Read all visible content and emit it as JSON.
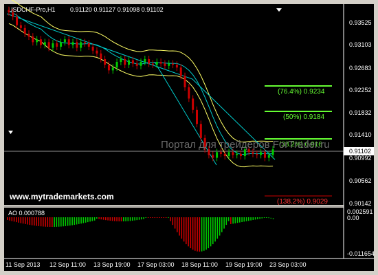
{
  "header": {
    "symbol_timeframe": "USDCHF-Pro,H1",
    "ohlc": "0.91120 0.91127 0.91098 0.91102"
  },
  "watermark": "Портал для трейдеров ForTrader.ru",
  "site_label": "www.mytrademarkets.com",
  "fib_levels": [
    {
      "label": "(76.4%) 0.9234",
      "color": "#66ff33"
    },
    {
      "label": "(50%) 0.9184",
      "color": "#66ff33"
    },
    {
      "label": "(38.2%) 0.916",
      "color": "#66ff33"
    },
    {
      "label": "(138.2%) 0.9029",
      "color": "#ff3333"
    }
  ],
  "price_axis": [
    "0.93525",
    "0.93103",
    "0.92683",
    "0.92252",
    "0.91832",
    "0.91410",
    "0.90992",
    "0.90562",
    "0.90142"
  ],
  "current_price": "0.91102",
  "ao_panel": {
    "label": "AO 0.000788",
    "axis": [
      "0.002591",
      "0.00",
      "-0.011654"
    ]
  },
  "time_axis": [
    "11 Sep 2013",
    "12 Sep 11:00",
    "13 Sep 19:00",
    "17 Sep 03:00",
    "18 Sep 11:00",
    "19 Sep 19:00",
    "23 Sep 03:00"
  ],
  "colors": {
    "background": "#000000",
    "bull": "#00cc00",
    "bear": "#cc0000",
    "bands": "#ffff66",
    "ma": "#00cccc",
    "grid_line": "#ffffff"
  },
  "chart_data": {
    "type": "candlestick",
    "close_series": [
      0.9353,
      0.9345,
      0.933,
      0.9325,
      0.9315,
      0.931,
      0.93,
      0.9305,
      0.9295,
      0.93,
      0.929,
      0.9298,
      0.9292,
      0.93,
      0.9305,
      0.9295,
      0.93,
      0.929,
      0.93,
      0.9298,
      0.9292,
      0.9285,
      0.928,
      0.927,
      0.926,
      0.925,
      0.9255,
      0.9265,
      0.927,
      0.926,
      0.9268,
      0.9262,
      0.9258,
      0.9265,
      0.927,
      0.9262,
      0.926,
      0.9265,
      0.9262,
      0.9258,
      0.9262,
      0.926,
      0.9255,
      0.924,
      0.922,
      0.92,
      0.918,
      0.9155,
      0.913,
      0.911,
      0.91,
      0.9095,
      0.9105,
      0.9102,
      0.9098,
      0.9105,
      0.91,
      0.9102,
      0.9098,
      0.911,
      0.9105,
      0.9102,
      0.91,
      0.9105,
      0.9095,
      0.91,
      0.911
    ],
    "ylim": [
      0.9014,
      0.9365
    ]
  }
}
